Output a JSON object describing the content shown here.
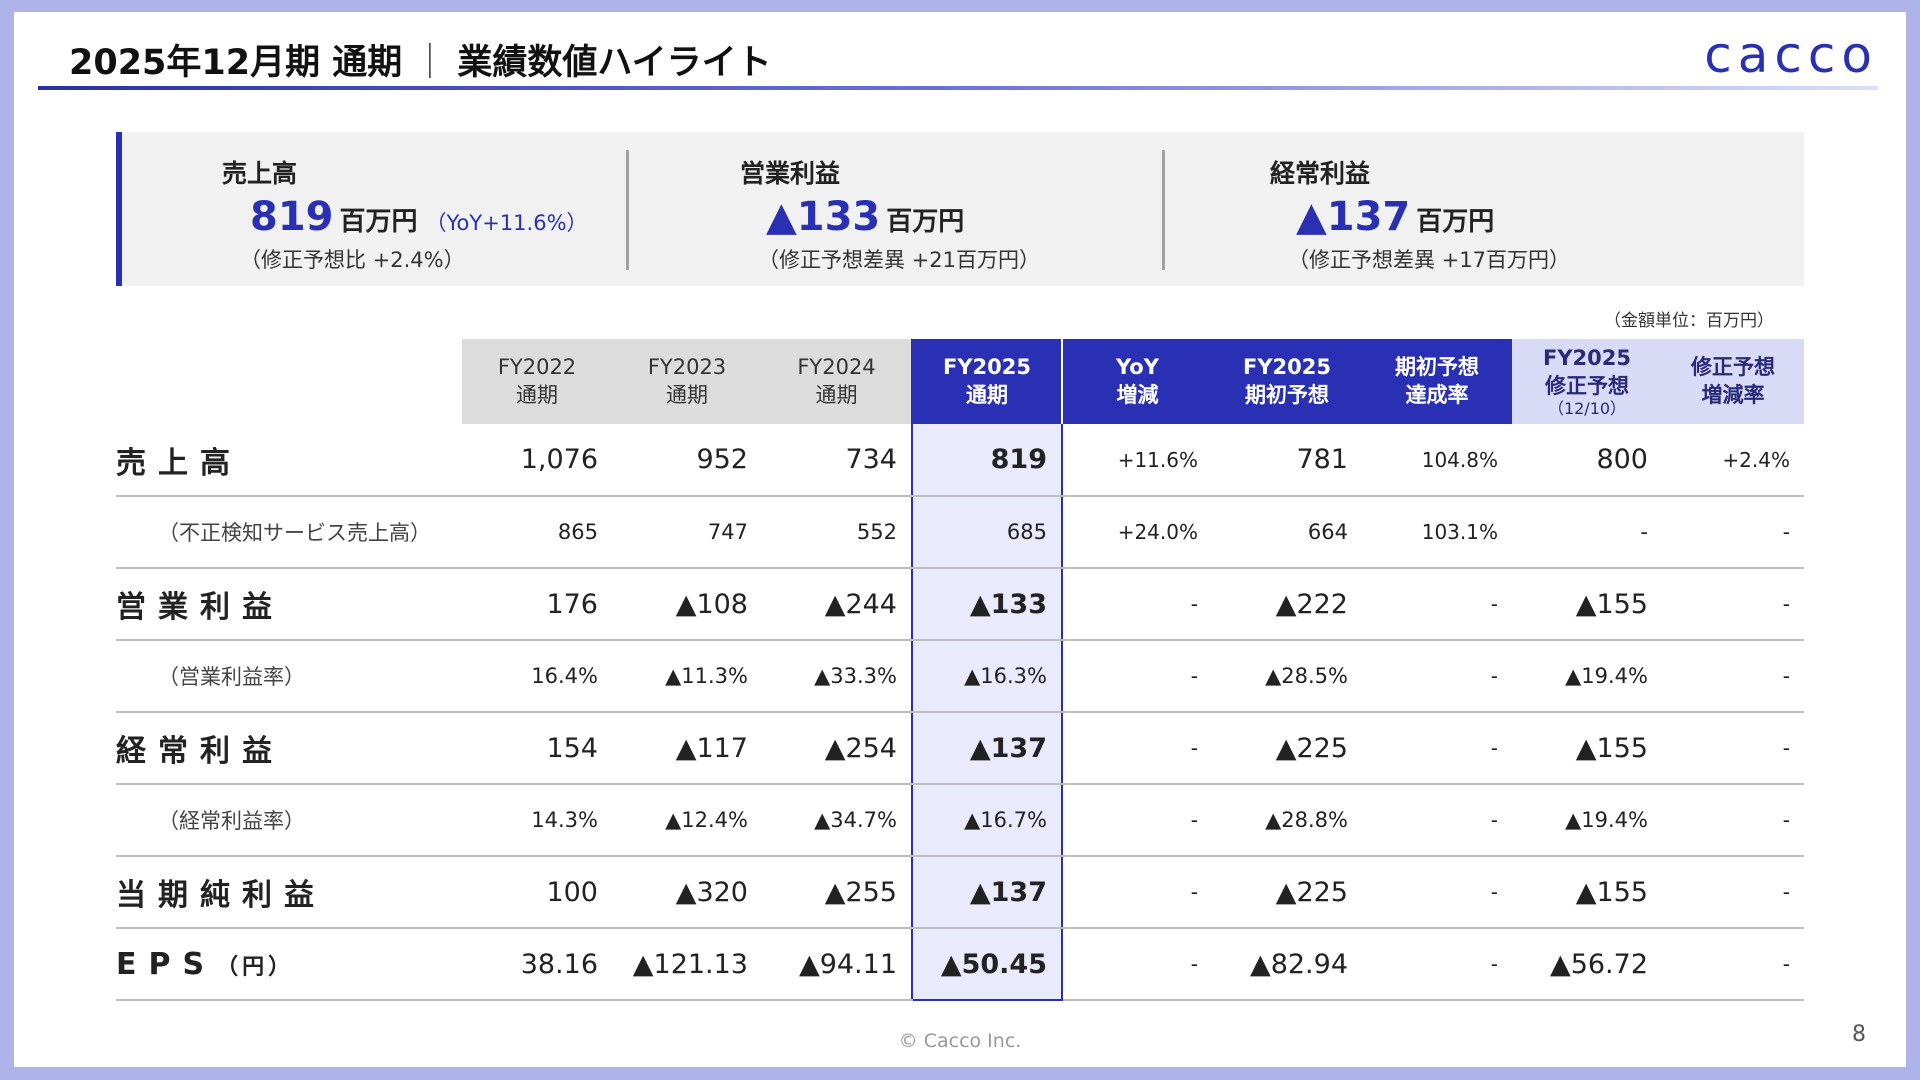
{
  "header": {
    "title_main": "2025年12月期 通期",
    "title_sep": "｜",
    "title_sub": "業績数値ハイライト",
    "logo": "cacco"
  },
  "summary": [
    {
      "label": "売上高",
      "value": "819",
      "unit": "百万円",
      "yoy": "（YoY+11.6%）",
      "sub": "（修正予想比 +2.4%）"
    },
    {
      "label": "営業利益",
      "value": "▲133",
      "unit": "百万円",
      "yoy": "",
      "sub": "（修正予想差異 +21百万円）"
    },
    {
      "label": "経常利益",
      "value": "▲137",
      "unit": "百万円",
      "yoy": "",
      "sub": "（修正予想差異 +17百万円）"
    }
  ],
  "unit_note": "（金額単位：百万円）",
  "table": {
    "headers": [
      {
        "line1": "FY2022",
        "line2": "通期",
        "line3": "",
        "style": "hist"
      },
      {
        "line1": "FY2023",
        "line2": "通期",
        "line3": "",
        "style": "hist"
      },
      {
        "line1": "FY2024",
        "line2": "通期",
        "line3": "",
        "style": "hist"
      },
      {
        "line1": "FY2025",
        "line2": "通期",
        "line3": "",
        "style": "dark"
      },
      {
        "line1": "YoY",
        "line2": "増減",
        "line3": "",
        "style": "dark"
      },
      {
        "line1": "FY2025",
        "line2": "期初予想",
        "line3": "",
        "style": "dark"
      },
      {
        "line1": "期初予想",
        "line2": "達成率",
        "line3": "",
        "style": "dark"
      },
      {
        "line1": "FY2025",
        "line2": "修正予想",
        "line3": "（12/10）",
        "style": "light"
      },
      {
        "line1": "修正予想",
        "line2": "増減率",
        "line3": "",
        "style": "light"
      }
    ],
    "rows": [
      {
        "label": "売上高",
        "type": "main",
        "values": [
          "1,076",
          "952",
          "734",
          "819",
          "+11.6%",
          "781",
          "104.8%",
          "800",
          "+2.4%"
        ]
      },
      {
        "label": "（不正検知サービス売上高）",
        "type": "sub",
        "values": [
          "865",
          "747",
          "552",
          "685",
          "+24.0%",
          "664",
          "103.1%",
          "-",
          "-"
        ]
      },
      {
        "label": "営業利益",
        "type": "main",
        "values": [
          "176",
          "▲108",
          "▲244",
          "▲133",
          "-",
          "▲222",
          "-",
          "▲155",
          "-"
        ]
      },
      {
        "label": "（営業利益率）",
        "type": "sub",
        "values": [
          "16.4%",
          "▲11.3%",
          "▲33.3%",
          "▲16.3%",
          "-",
          "▲28.5%",
          "-",
          "▲19.4%",
          "-"
        ]
      },
      {
        "label": "経常利益",
        "type": "main",
        "values": [
          "154",
          "▲117",
          "▲254",
          "▲137",
          "-",
          "▲225",
          "-",
          "▲155",
          "-"
        ]
      },
      {
        "label": "（経常利益率）",
        "type": "sub",
        "values": [
          "14.3%",
          "▲12.4%",
          "▲34.7%",
          "▲16.7%",
          "-",
          "▲28.8%",
          "-",
          "▲19.4%",
          "-"
        ]
      },
      {
        "label": "当期純利益",
        "type": "main",
        "values": [
          "100",
          "▲320",
          "▲255",
          "▲137",
          "-",
          "▲225",
          "-",
          "▲155",
          "-"
        ]
      },
      {
        "label": "EPS",
        "label_suffix": "（円）",
        "type": "main",
        "values": [
          "38.16",
          "▲121.13",
          "▲94.11",
          "▲50.45",
          "-",
          "▲82.94",
          "-",
          "▲56.72",
          "-"
        ]
      }
    ]
  },
  "footer": {
    "copyright": "© Cacco Inc.",
    "page": "8"
  },
  "colors": {
    "accent": "#2a30b3",
    "frame": "#aeb3ea",
    "highlight": "#e9eafb",
    "light_header": "#d9dbf6"
  }
}
